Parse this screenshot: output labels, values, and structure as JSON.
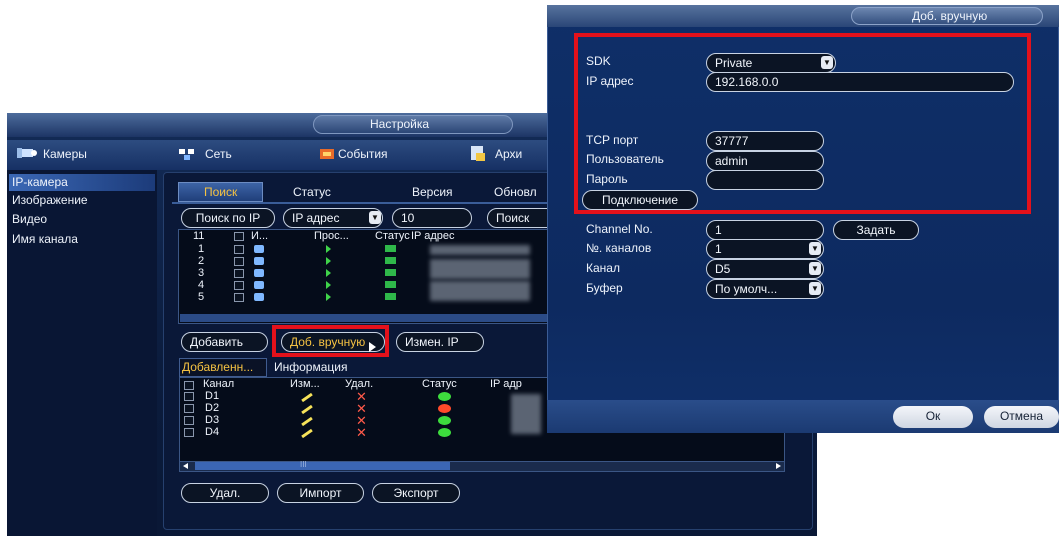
{
  "main_window": {
    "title": "Настройка",
    "sidebar": {
      "header": "Камеры",
      "items": [
        "IP-камера",
        "Изображение",
        "Видео",
        "Имя канала"
      ]
    },
    "top_menu": [
      "Сеть",
      "События",
      "Архи"
    ],
    "tabs": [
      "Поиск",
      "Статус",
      "Версия",
      "Обновл"
    ],
    "search_bar": {
      "search_by_ip": "Поиск по IP",
      "ip_mode": "IP адрес",
      "count": "10",
      "search_btn": "Поиск"
    },
    "device_table": {
      "headers": [
        "11",
        "И...",
        "Прос...",
        "Статус",
        "IP адрес"
      ],
      "rows": [
        "1",
        "2",
        "3",
        "4",
        "5"
      ]
    },
    "actions": {
      "add": "Добавить",
      "manual_add": "Доб. вручную",
      "change_ip": "Измен. IP"
    },
    "added_tabs": [
      "Добавленн...",
      "Информация"
    ],
    "added_table": {
      "headers": [
        "Канал",
        "Изм...",
        "Удал.",
        "Статус",
        "IP адр"
      ],
      "rows": [
        {
          "channel": "D1",
          "status_color": "#3ddc3d"
        },
        {
          "channel": "D2",
          "status_color": "#ff4a2a"
        },
        {
          "channel": "D3",
          "status_color": "#3ddc3d"
        },
        {
          "channel": "D4",
          "status_color": "#3ddc3d"
        }
      ],
      "scroll_mark": "III"
    },
    "bottom_buttons": [
      "Удал.",
      "Импорт",
      "Экспорт"
    ]
  },
  "dialog": {
    "title": "Доб. вручную",
    "fields": {
      "sdk_label": "SDK",
      "sdk_value": "Private",
      "ip_label": "IP адрес",
      "ip_value": "192.168.0.0",
      "tcp_label": "TCP порт",
      "tcp_value": "37777",
      "user_label": "Пользователь",
      "user_value": "admin",
      "pass_label": "Пароль",
      "pass_value": "",
      "connect_btn": "Подключение",
      "channel_no_label": "Channel No.",
      "channel_no_value": "1",
      "set_btn": "Задать",
      "num_channels_label": "№. каналов",
      "num_channels_value": "1",
      "channel_label": "Канал",
      "channel_value": "D5",
      "buffer_label": "Буфер",
      "buffer_value": "По умолч..."
    },
    "ok": "Ок",
    "cancel": "Отмена"
  },
  "colors": {
    "highlight_red": "#e3111b",
    "dialog_bg": "#0e2a5e",
    "panel_bg": "#0a1a3a"
  }
}
